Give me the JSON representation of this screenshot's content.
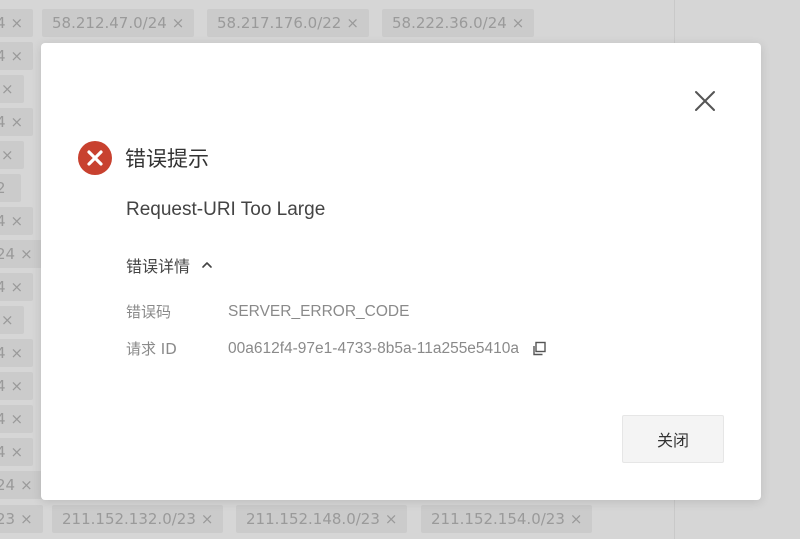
{
  "background": {
    "tags": [
      {
        "label": "4",
        "x_label": "×"
      },
      {
        "label": "58.212.47.0/24",
        "x_label": "×"
      },
      {
        "label": "58.217.176.0/22",
        "x_label": "×"
      },
      {
        "label": "58.222.36.0/24",
        "x_label": "×"
      },
      {
        "label": "4",
        "x_label": "×"
      },
      {
        "label": "",
        "x_label": "×"
      },
      {
        "label": "4",
        "x_label": "×"
      },
      {
        "label": "",
        "x_label": "×"
      },
      {
        "label": "2",
        "x_label": ""
      },
      {
        "label": "4",
        "x_label": "×"
      },
      {
        "label": "24",
        "x_label": "×"
      },
      {
        "label": "4",
        "x_label": "×"
      },
      {
        "label": "",
        "x_label": "×"
      },
      {
        "label": "4",
        "x_label": "×"
      },
      {
        "label": "4",
        "x_label": "×"
      },
      {
        "label": "4",
        "x_label": "×"
      },
      {
        "label": "4",
        "x_label": "×"
      },
      {
        "label": "24",
        "x_label": "×"
      },
      {
        "label": "23",
        "x_label": "×"
      },
      {
        "label": "211.152.132.0/23",
        "x_label": "×"
      },
      {
        "label": "211.152.148.0/23",
        "x_label": "×"
      },
      {
        "label": "211.152.154.0/23",
        "x_label": "×"
      }
    ]
  },
  "dialog": {
    "title": "错误提示",
    "message": "Request-URI Too Large",
    "details_label": "错误详情",
    "details": {
      "code_label": "错误码",
      "code_value": "SERVER_ERROR_CODE",
      "request_id_label": "请求 ID",
      "request_id_value": "00a612f4-97e1-4733-8b5a-11a255e5410a"
    },
    "close_button": "关闭",
    "colors": {
      "error_icon": "#c8412f",
      "button_bg": "#f4f4f4",
      "overlay": "#d6d6d6"
    },
    "icons": [
      "close-icon",
      "error-icon",
      "chevron-up-icon",
      "copy-icon"
    ]
  }
}
